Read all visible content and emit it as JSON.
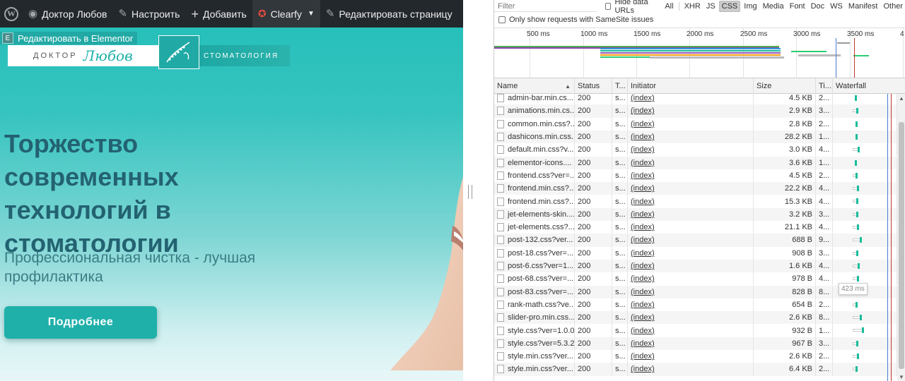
{
  "adminbar": {
    "site_name": "Доктор Любов",
    "customize": "Настроить",
    "new": "Добавить",
    "clearfy": "Clearfy",
    "edit_page": "Редактировать страницу"
  },
  "elementor": {
    "badge": "E",
    "edit_label": "Редактировать в Elementor"
  },
  "logo": {
    "left": "ДОКТОР",
    "script": "Любов",
    "right": "СТОМАТОЛОГИЯ"
  },
  "hero": {
    "title": "Торжество современных технологий в стоматологии",
    "subtitle": "Профессиональная чистка - лучшая профилактика",
    "button": "Подробнее"
  },
  "devtools": {
    "filter_placeholder": "Filter",
    "hide_data_urls": "Hide data URLs",
    "types": [
      "All",
      "XHR",
      "JS",
      "CSS",
      "Img",
      "Media",
      "Font",
      "Doc",
      "WS",
      "Manifest",
      "Other"
    ],
    "selected_type": "CSS",
    "samesite": "Only show requests with SameSite issues",
    "overview_ticks": [
      "500 ms",
      "1000 ms",
      "1500 ms",
      "2000 ms",
      "2500 ms",
      "3000 ms",
      "3500 ms",
      "4"
    ],
    "columns": {
      "name": "Name",
      "status": "Status",
      "type": "T...",
      "initiator": "Initiator",
      "size": "Size",
      "time": "Ti...",
      "waterfall": "Waterfall"
    },
    "tooltip": "423 ms",
    "rows": [
      {
        "name": "admin-bar.min.cs...",
        "status": "200",
        "type": "s...",
        "initiator": "(index)",
        "size": "4.5 KB",
        "time": "2..."
      },
      {
        "name": "animations.min.cs...",
        "status": "200",
        "type": "s...",
        "initiator": "(index)",
        "size": "2.9 KB",
        "time": "3..."
      },
      {
        "name": "common.min.css?...",
        "status": "200",
        "type": "s...",
        "initiator": "(index)",
        "size": "2.8 KB",
        "time": "2..."
      },
      {
        "name": "dashicons.min.css...",
        "status": "200",
        "type": "s...",
        "initiator": "(index)",
        "size": "28.2 KB",
        "time": "1..."
      },
      {
        "name": "default.min.css?v...",
        "status": "200",
        "type": "s...",
        "initiator": "(index)",
        "size": "3.0 KB",
        "time": "4..."
      },
      {
        "name": "elementor-icons....",
        "status": "200",
        "type": "s...",
        "initiator": "(index)",
        "size": "3.6 KB",
        "time": "1..."
      },
      {
        "name": "frontend.css?ver=...",
        "status": "200",
        "type": "s...",
        "initiator": "(index)",
        "size": "4.5 KB",
        "time": "2..."
      },
      {
        "name": "frontend.min.css?...",
        "status": "200",
        "type": "s...",
        "initiator": "(index)",
        "size": "22.2 KB",
        "time": "4..."
      },
      {
        "name": "frontend.min.css?...",
        "status": "200",
        "type": "s...",
        "initiator": "(index)",
        "size": "15.3 KB",
        "time": "4..."
      },
      {
        "name": "jet-elements-skin....",
        "status": "200",
        "type": "s...",
        "initiator": "(index)",
        "size": "3.2 KB",
        "time": "3..."
      },
      {
        "name": "jet-elements.css?...",
        "status": "200",
        "type": "s...",
        "initiator": "(index)",
        "size": "21.1 KB",
        "time": "4..."
      },
      {
        "name": "post-132.css?ver...",
        "status": "200",
        "type": "s...",
        "initiator": "(index)",
        "size": "688 B",
        "time": "9..."
      },
      {
        "name": "post-18.css?ver=...",
        "status": "200",
        "type": "s...",
        "initiator": "(index)",
        "size": "908 B",
        "time": "3..."
      },
      {
        "name": "post-6.css?ver=1...",
        "status": "200",
        "type": "s...",
        "initiator": "(index)",
        "size": "1.6 KB",
        "time": "4..."
      },
      {
        "name": "post-68.css?ver=...",
        "status": "200",
        "type": "s...",
        "initiator": "(index)",
        "size": "978 B",
        "time": "4..."
      },
      {
        "name": "post-83.css?ver=...",
        "status": "200",
        "type": "s...",
        "initiator": "(index)",
        "size": "828 B",
        "time": "8..."
      },
      {
        "name": "rank-math.css?ve...",
        "status": "200",
        "type": "s...",
        "initiator": "(index)",
        "size": "654 B",
        "time": "2..."
      },
      {
        "name": "slider-pro.min.css...",
        "status": "200",
        "type": "s...",
        "initiator": "(index)",
        "size": "2.6 KB",
        "time": "8..."
      },
      {
        "name": "style.css?ver=1.0.0",
        "status": "200",
        "type": "s...",
        "initiator": "(index)",
        "size": "932 B",
        "time": "1..."
      },
      {
        "name": "style.css?ver=5.3.2",
        "status": "200",
        "type": "s...",
        "initiator": "(index)",
        "size": "967 B",
        "time": "3..."
      },
      {
        "name": "style.min.css?ver...",
        "status": "200",
        "type": "s...",
        "initiator": "(index)",
        "size": "2.6 KB",
        "time": "2..."
      },
      {
        "name": "style.min.css?ver...",
        "status": "200",
        "type": "s...",
        "initiator": "(index)",
        "size": "6.4 KB",
        "time": "2..."
      }
    ]
  },
  "colors": {
    "accent": "#1eb0a9",
    "title": "#236271",
    "adminbar": "#23282d",
    "waterfall_green": "#1abc9c"
  }
}
